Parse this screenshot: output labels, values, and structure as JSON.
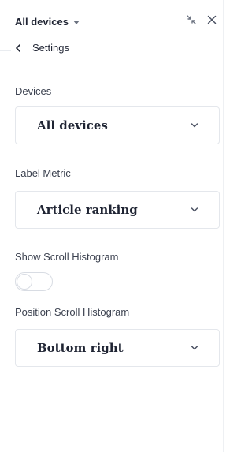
{
  "header": {
    "device_title": "All devices",
    "icons": {
      "device_dropdown": "caret-down-icon",
      "collapse": "collapse-arrows-icon",
      "close": "close-icon"
    }
  },
  "nav": {
    "back_label": "Settings",
    "back_icon": "chevron-left-icon"
  },
  "fields": {
    "devices": {
      "label": "Devices",
      "value": "All devices"
    },
    "label_metric": {
      "label": "Label Metric",
      "value": "Article ranking"
    },
    "show_scroll_histogram": {
      "label": "Show Scroll Histogram",
      "enabled": false
    },
    "position_scroll_histogram": {
      "label": "Position Scroll Histogram",
      "value": "Bottom right"
    }
  },
  "colors": {
    "text": "#1f2433",
    "muted": "#3c4250",
    "border": "#e4e7ec",
    "icon": "#6b7280"
  }
}
